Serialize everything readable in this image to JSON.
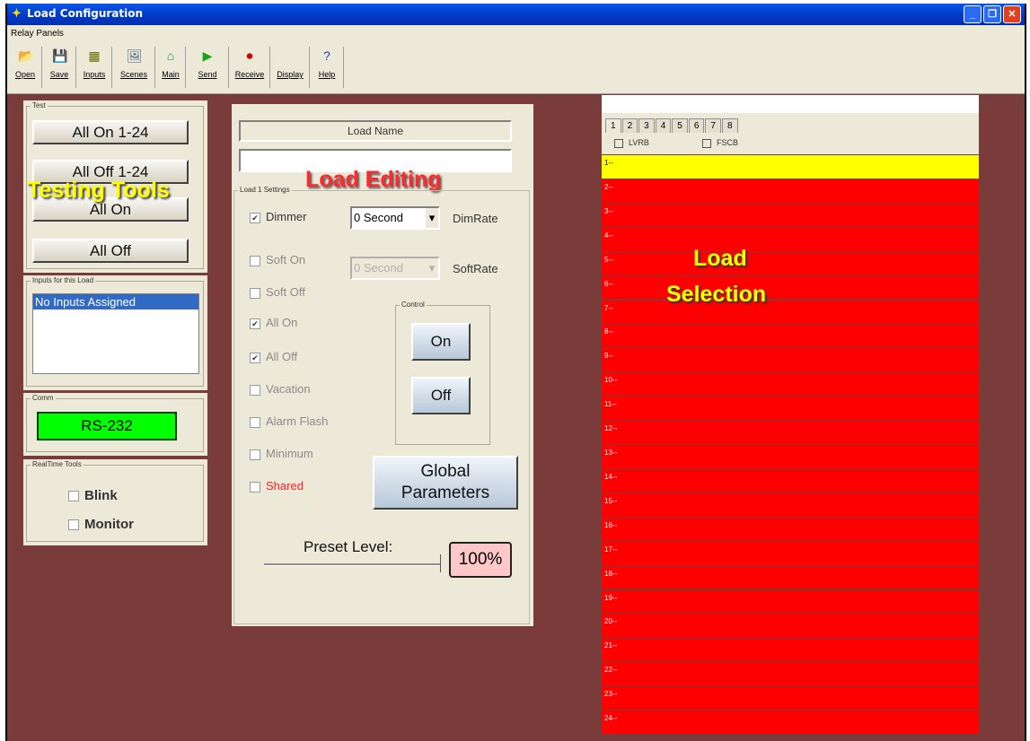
{
  "window": {
    "title": "Load Configuration",
    "icon": "load-config-icon"
  },
  "menu": {
    "item": "Relay Panels"
  },
  "toolbar": [
    {
      "label": "Open",
      "icon": "folder-open-icon",
      "glyph": "📂"
    },
    {
      "label": "Save",
      "icon": "floppy-disk-icon",
      "glyph": "💾"
    },
    {
      "label": "Inputs",
      "icon": "grid-icon",
      "glyph": "▦"
    },
    {
      "label": "Scenes",
      "icon": "scenes-icon",
      "glyph": "🖼"
    },
    {
      "label": "Main",
      "icon": "home-icon",
      "glyph": "⌂"
    },
    {
      "label": "Send",
      "icon": "play-arrow-icon",
      "glyph": "▶"
    },
    {
      "label": "Receive",
      "icon": "record-icon",
      "glyph": "⏺"
    },
    {
      "label": "Display",
      "icon": "",
      "glyph": ""
    },
    {
      "label": "Help",
      "icon": "help-icon",
      "glyph": "?"
    }
  ],
  "test": {
    "group": "Test",
    "buttons": [
      "All On 1-24",
      "All Off 1-24",
      "All On",
      "All Off"
    ],
    "overlay": "Testing Tools"
  },
  "inputs": {
    "group": "Inputs for this Load",
    "items": [
      "No Inputs Assigned"
    ]
  },
  "comm": {
    "group": "Comm",
    "value": "RS-232",
    "color": "#00ff00"
  },
  "realtime": {
    "group": "RealTime Tools",
    "blink": "Blink",
    "monitor": "Monitor"
  },
  "load_name": {
    "label": "Load Name",
    "value": "",
    "overlay": "Load Editing"
  },
  "settings": {
    "group": "Load 1 Settings",
    "dimmer": "Dimmer",
    "soft_on": "Soft On",
    "soft_off": "Soft Off",
    "all_on": "All On",
    "all_off": "All Off",
    "vacation": "Vacation",
    "alarm_flash": "Alarm Flash",
    "minimum": "Minimum",
    "shared": "Shared",
    "dim_rate_value": "0 Second",
    "dim_rate_label": "DimRate",
    "soft_rate_value": "0 Second",
    "soft_rate_label": "SoftRate",
    "control_group": "Control",
    "on": "On",
    "off": "Off",
    "global": [
      "Global",
      "Parameters"
    ],
    "preset_label": "Preset Level:",
    "preset_value": "100%",
    "preset_level": 1.0,
    "checked": {
      "dimmer": true,
      "soft_on": false,
      "soft_off": false,
      "all_on": true,
      "all_off": true,
      "vacation": false,
      "alarm_flash": false,
      "minimum": false,
      "shared": false
    }
  },
  "selection": {
    "tabs": [
      "1",
      "2",
      "3",
      "4",
      "5",
      "6",
      "7",
      "8"
    ],
    "active_tab": "1",
    "options": [
      "LVRB",
      "FSCB"
    ],
    "overlay": [
      "Load",
      "Selection"
    ],
    "rows": [
      "1--",
      "2--",
      "3--",
      "4--",
      "5--",
      "6--",
      "7--",
      "8--",
      "9--",
      "10--",
      "11--",
      "12--",
      "13--",
      "14--",
      "15--",
      "16--",
      "17--",
      "18--",
      "19--",
      "20--",
      "21--",
      "22--",
      "23--",
      "24--"
    ],
    "selected_row": 0,
    "colors": {
      "selected": "#ffff00",
      "normal": "#ff0000"
    }
  },
  "colors": {
    "overlay_text": "#ffff00",
    "overlay_editing": "#ff2a2a",
    "background": "#7a3b3b"
  },
  "glyphs": {
    "check": "✔",
    "dropdown": "▾",
    "minimize": "_",
    "maximize": "❐",
    "close": "✕"
  }
}
